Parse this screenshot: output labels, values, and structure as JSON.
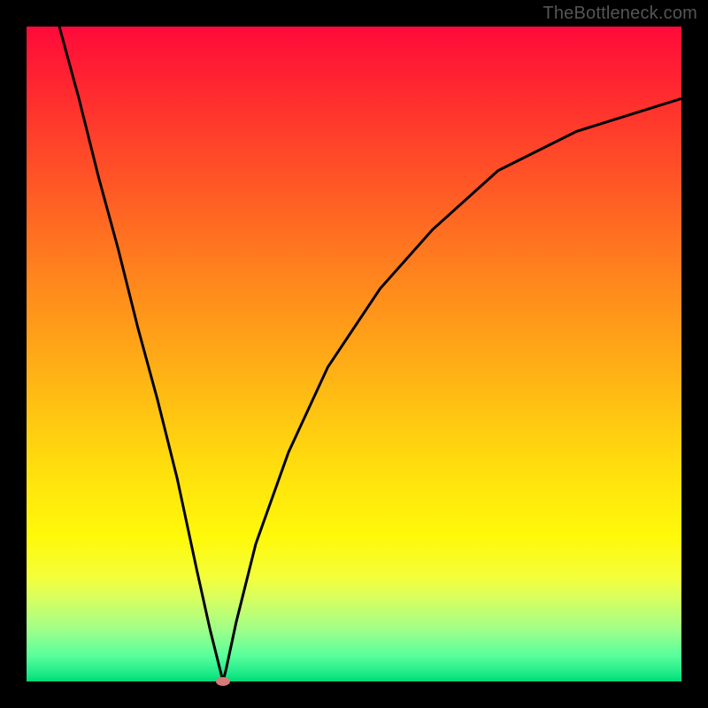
{
  "watermark": "TheBottleneck.com",
  "chart_data": {
    "type": "line",
    "title": "",
    "xlabel": "",
    "ylabel": "",
    "xlim": [
      0,
      100
    ],
    "ylim": [
      0,
      100
    ],
    "grid": false,
    "legend": false,
    "curve": {
      "x_min_at": 30,
      "x": [
        5,
        8,
        11,
        14,
        17,
        20,
        23,
        26,
        28,
        29.5,
        30,
        30.5,
        32,
        35,
        40,
        46,
        54,
        62,
        72,
        84,
        100
      ],
      "y": [
        100,
        89,
        77,
        66,
        54,
        43,
        31,
        17,
        8,
        2,
        0,
        2,
        9,
        21,
        35,
        48,
        60,
        69,
        78,
        84,
        89
      ]
    },
    "marker": {
      "x": 30,
      "y": 0
    },
    "background_gradient": [
      "#ff0a3a",
      "#ff5a25",
      "#ffb814",
      "#fff90a",
      "#a0ff88",
      "#00d876"
    ]
  }
}
